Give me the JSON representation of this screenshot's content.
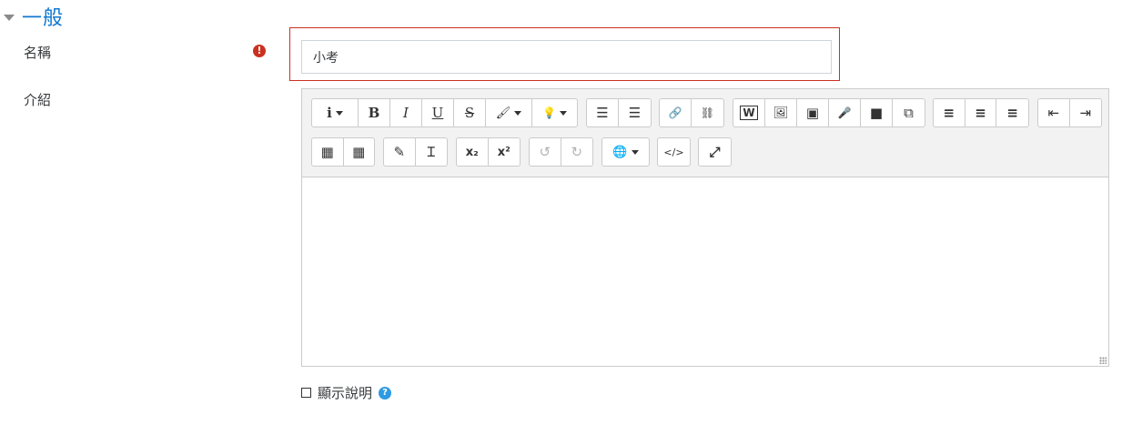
{
  "section": {
    "title": "一般"
  },
  "fields": {
    "name_label": "名稱",
    "name_value": "小考",
    "required_glyph": "!",
    "intro_label": "介紹"
  },
  "toolbar": {
    "row1": [
      {
        "name": "paragraph-styles",
        "label": "i",
        "dropdown": true
      },
      {
        "name": "bold",
        "label": "B"
      },
      {
        "name": "italic",
        "label": "I"
      },
      {
        "name": "underline",
        "label": "U"
      },
      {
        "name": "strikethrough",
        "label": "S"
      },
      {
        "name": "font-color",
        "label": "🖌",
        "dropdown": true
      },
      {
        "name": "background-color",
        "label": "💡",
        "dropdown": true
      },
      {
        "name": "unordered-list",
        "label": "☰"
      },
      {
        "name": "ordered-list",
        "label": "☰"
      },
      {
        "name": "link",
        "label": "🔗"
      },
      {
        "name": "unlink",
        "label": "⛓"
      },
      {
        "name": "word-import",
        "label": "W"
      },
      {
        "name": "image",
        "label": "🖼"
      },
      {
        "name": "media",
        "label": "▣"
      },
      {
        "name": "record-audio",
        "label": "🎤"
      },
      {
        "name": "record-video",
        "label": "■"
      },
      {
        "name": "manage-files",
        "label": "⧉"
      },
      {
        "name": "align-left",
        "label": "≡"
      },
      {
        "name": "align-center",
        "label": "≡"
      },
      {
        "name": "align-right",
        "label": "≡"
      },
      {
        "name": "outdent",
        "label": "⇤"
      },
      {
        "name": "indent",
        "label": "⇥"
      }
    ],
    "row2": [
      {
        "name": "table",
        "label": "▦"
      },
      {
        "name": "calculator",
        "label": "▦"
      },
      {
        "name": "equation",
        "label": "✎"
      },
      {
        "name": "special-chars",
        "label": "Ɪ"
      },
      {
        "name": "subscript",
        "label": "x₂"
      },
      {
        "name": "superscript",
        "label": "x²"
      },
      {
        "name": "undo",
        "label": "↺",
        "disabled": true
      },
      {
        "name": "redo",
        "label": "↻",
        "disabled": true
      },
      {
        "name": "language",
        "label": "🌐",
        "dropdown": true
      },
      {
        "name": "html",
        "label": "</>"
      },
      {
        "name": "fullscreen",
        "label": "⤢"
      }
    ]
  },
  "show_description": {
    "label": "顯示說明",
    "checked": false,
    "help_glyph": "?"
  },
  "colors": {
    "accent": "#1177d1",
    "error": "#ca3120",
    "help": "#2f9ae2"
  }
}
